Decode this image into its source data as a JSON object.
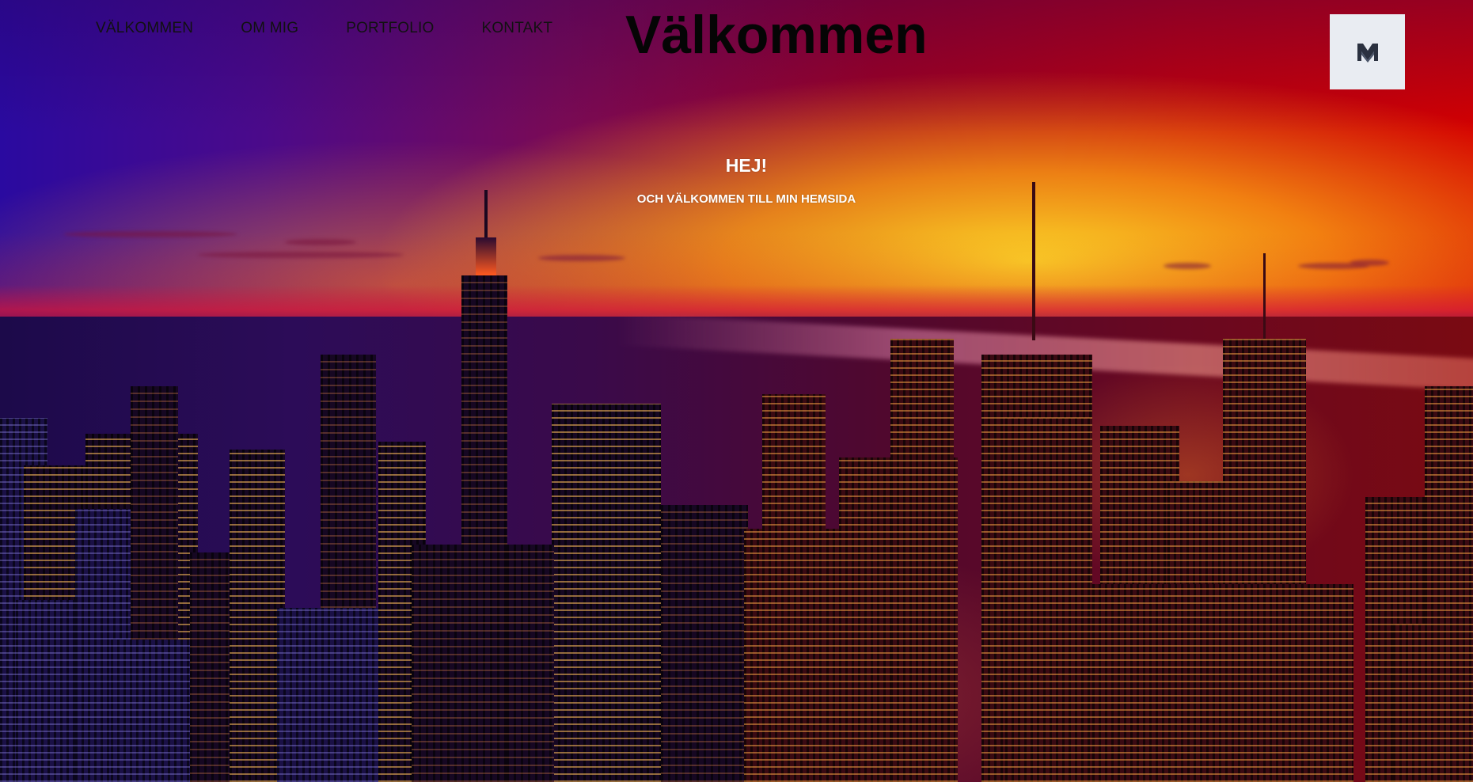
{
  "nav": {
    "items": [
      {
        "label": "VÄLKOMMEN"
      },
      {
        "label": "OM MIG"
      },
      {
        "label": "PORTFOLIO"
      },
      {
        "label": "KONTAKT"
      }
    ]
  },
  "header": {
    "title": "Välkommen"
  },
  "logo": {
    "icon": "m-monogram-icon",
    "background": "#e9ecf2",
    "color": "#2b3140"
  },
  "hero": {
    "heading": "HEJ!",
    "subheading": "OCH VÄLKOMMEN TILL MIN HEMSIDA",
    "background_image": "city-skyline-sunset"
  }
}
